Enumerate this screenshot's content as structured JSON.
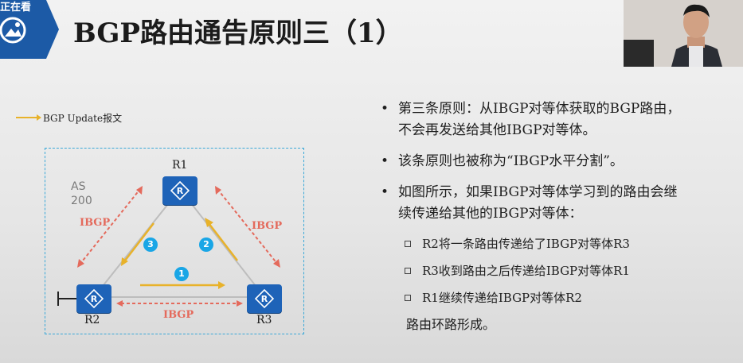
{
  "badge": {
    "text": "正在看",
    "color": "#1c5aa6"
  },
  "title": "BGP路由通告原则三（1）",
  "legend": {
    "label": "BGP Update报文",
    "color": "#e8b22a"
  },
  "diagram": {
    "as_label_line1": "AS",
    "as_label_line2": "200",
    "routers": [
      {
        "name": "R1"
      },
      {
        "name": "R2"
      },
      {
        "name": "R3"
      }
    ],
    "ibgp_left": "IBGP",
    "ibgp_right": "IBGP",
    "ibgp_bottom": "IBGP",
    "steps": [
      "1",
      "2",
      "3"
    ],
    "colors": {
      "router": "#1e63b8",
      "ibgp": "#e46a5c",
      "update": "#e8b22a",
      "step": "#19a6e6",
      "frame": "#3aa8d8"
    }
  },
  "bullets": [
    {
      "text": "第三条原则：从IBGP对等体获取的BGP路由，",
      "text2": "不会再发送给其他IBGP对等体。"
    },
    {
      "text": "该条原则也被称为“IBGP水平分割”。"
    },
    {
      "text": "如图所示，如果IBGP对等体学习到的路由会继",
      "text2": "续传递给其他的IBGP对等体："
    }
  ],
  "sub_items": [
    "R2将一条路由传递给了IBGP对等体R3",
    "R3收到路由之后传递给IBGP对等体R1",
    "R1继续传递给IBGP对等体R2"
  ],
  "conclusion": "路由环路形成。"
}
